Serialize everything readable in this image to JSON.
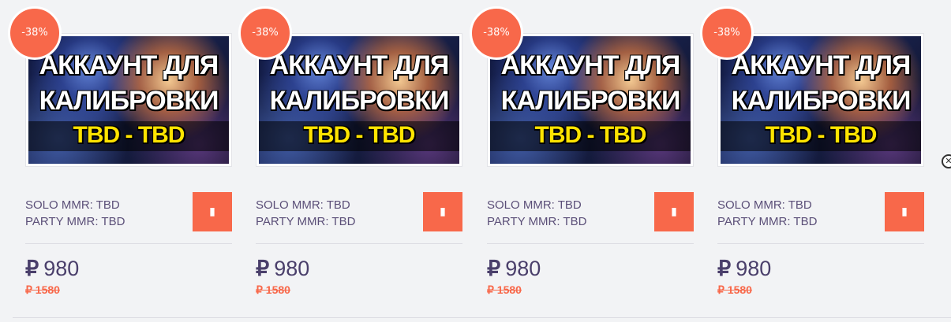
{
  "products": [
    {
      "discount": "-38%",
      "image_line1": "АККАУНТ ДЛЯ",
      "image_line2": "КАЛИБРОВКИ",
      "image_line3": "TBD - TBD",
      "solo_mmr": "SOLO MMR: TBD",
      "party_mmr": "PARTY MMR: TBD",
      "currency": "₽",
      "price": "980",
      "old_price": "₽ 1580"
    },
    {
      "discount": "-38%",
      "image_line1": "АККАУНТ ДЛЯ",
      "image_line2": "КАЛИБРОВКИ",
      "image_line3": "TBD - TBD",
      "solo_mmr": "SOLO MMR: TBD",
      "party_mmr": "PARTY MMR: TBD",
      "currency": "₽",
      "price": "980",
      "old_price": "₽ 1580"
    },
    {
      "discount": "-38%",
      "image_line1": "АККАУНТ ДЛЯ",
      "image_line2": "КАЛИБРОВКИ",
      "image_line3": "TBD - TBD",
      "solo_mmr": "SOLO MMR: TBD",
      "party_mmr": "PARTY MMR: TBD",
      "currency": "₽",
      "price": "980",
      "old_price": "₽ 1580"
    },
    {
      "discount": "-38%",
      "image_line1": "АККАУНТ ДЛЯ",
      "image_line2": "КАЛИБРОВКИ",
      "image_line3": "TBD - TBD",
      "solo_mmr": "SOLO MMR: TBD",
      "party_mmr": "PARTY MMR: TBD",
      "currency": "₽",
      "price": "980",
      "old_price": "₽ 1580"
    }
  ],
  "icons": {
    "cart_icon": "book-cart-icon",
    "close_icon": "close-icon"
  },
  "colors": {
    "accent": "#f8684a",
    "text": "#5b4f78",
    "price": "#4a3f6b",
    "background": "#f2f3f5"
  }
}
